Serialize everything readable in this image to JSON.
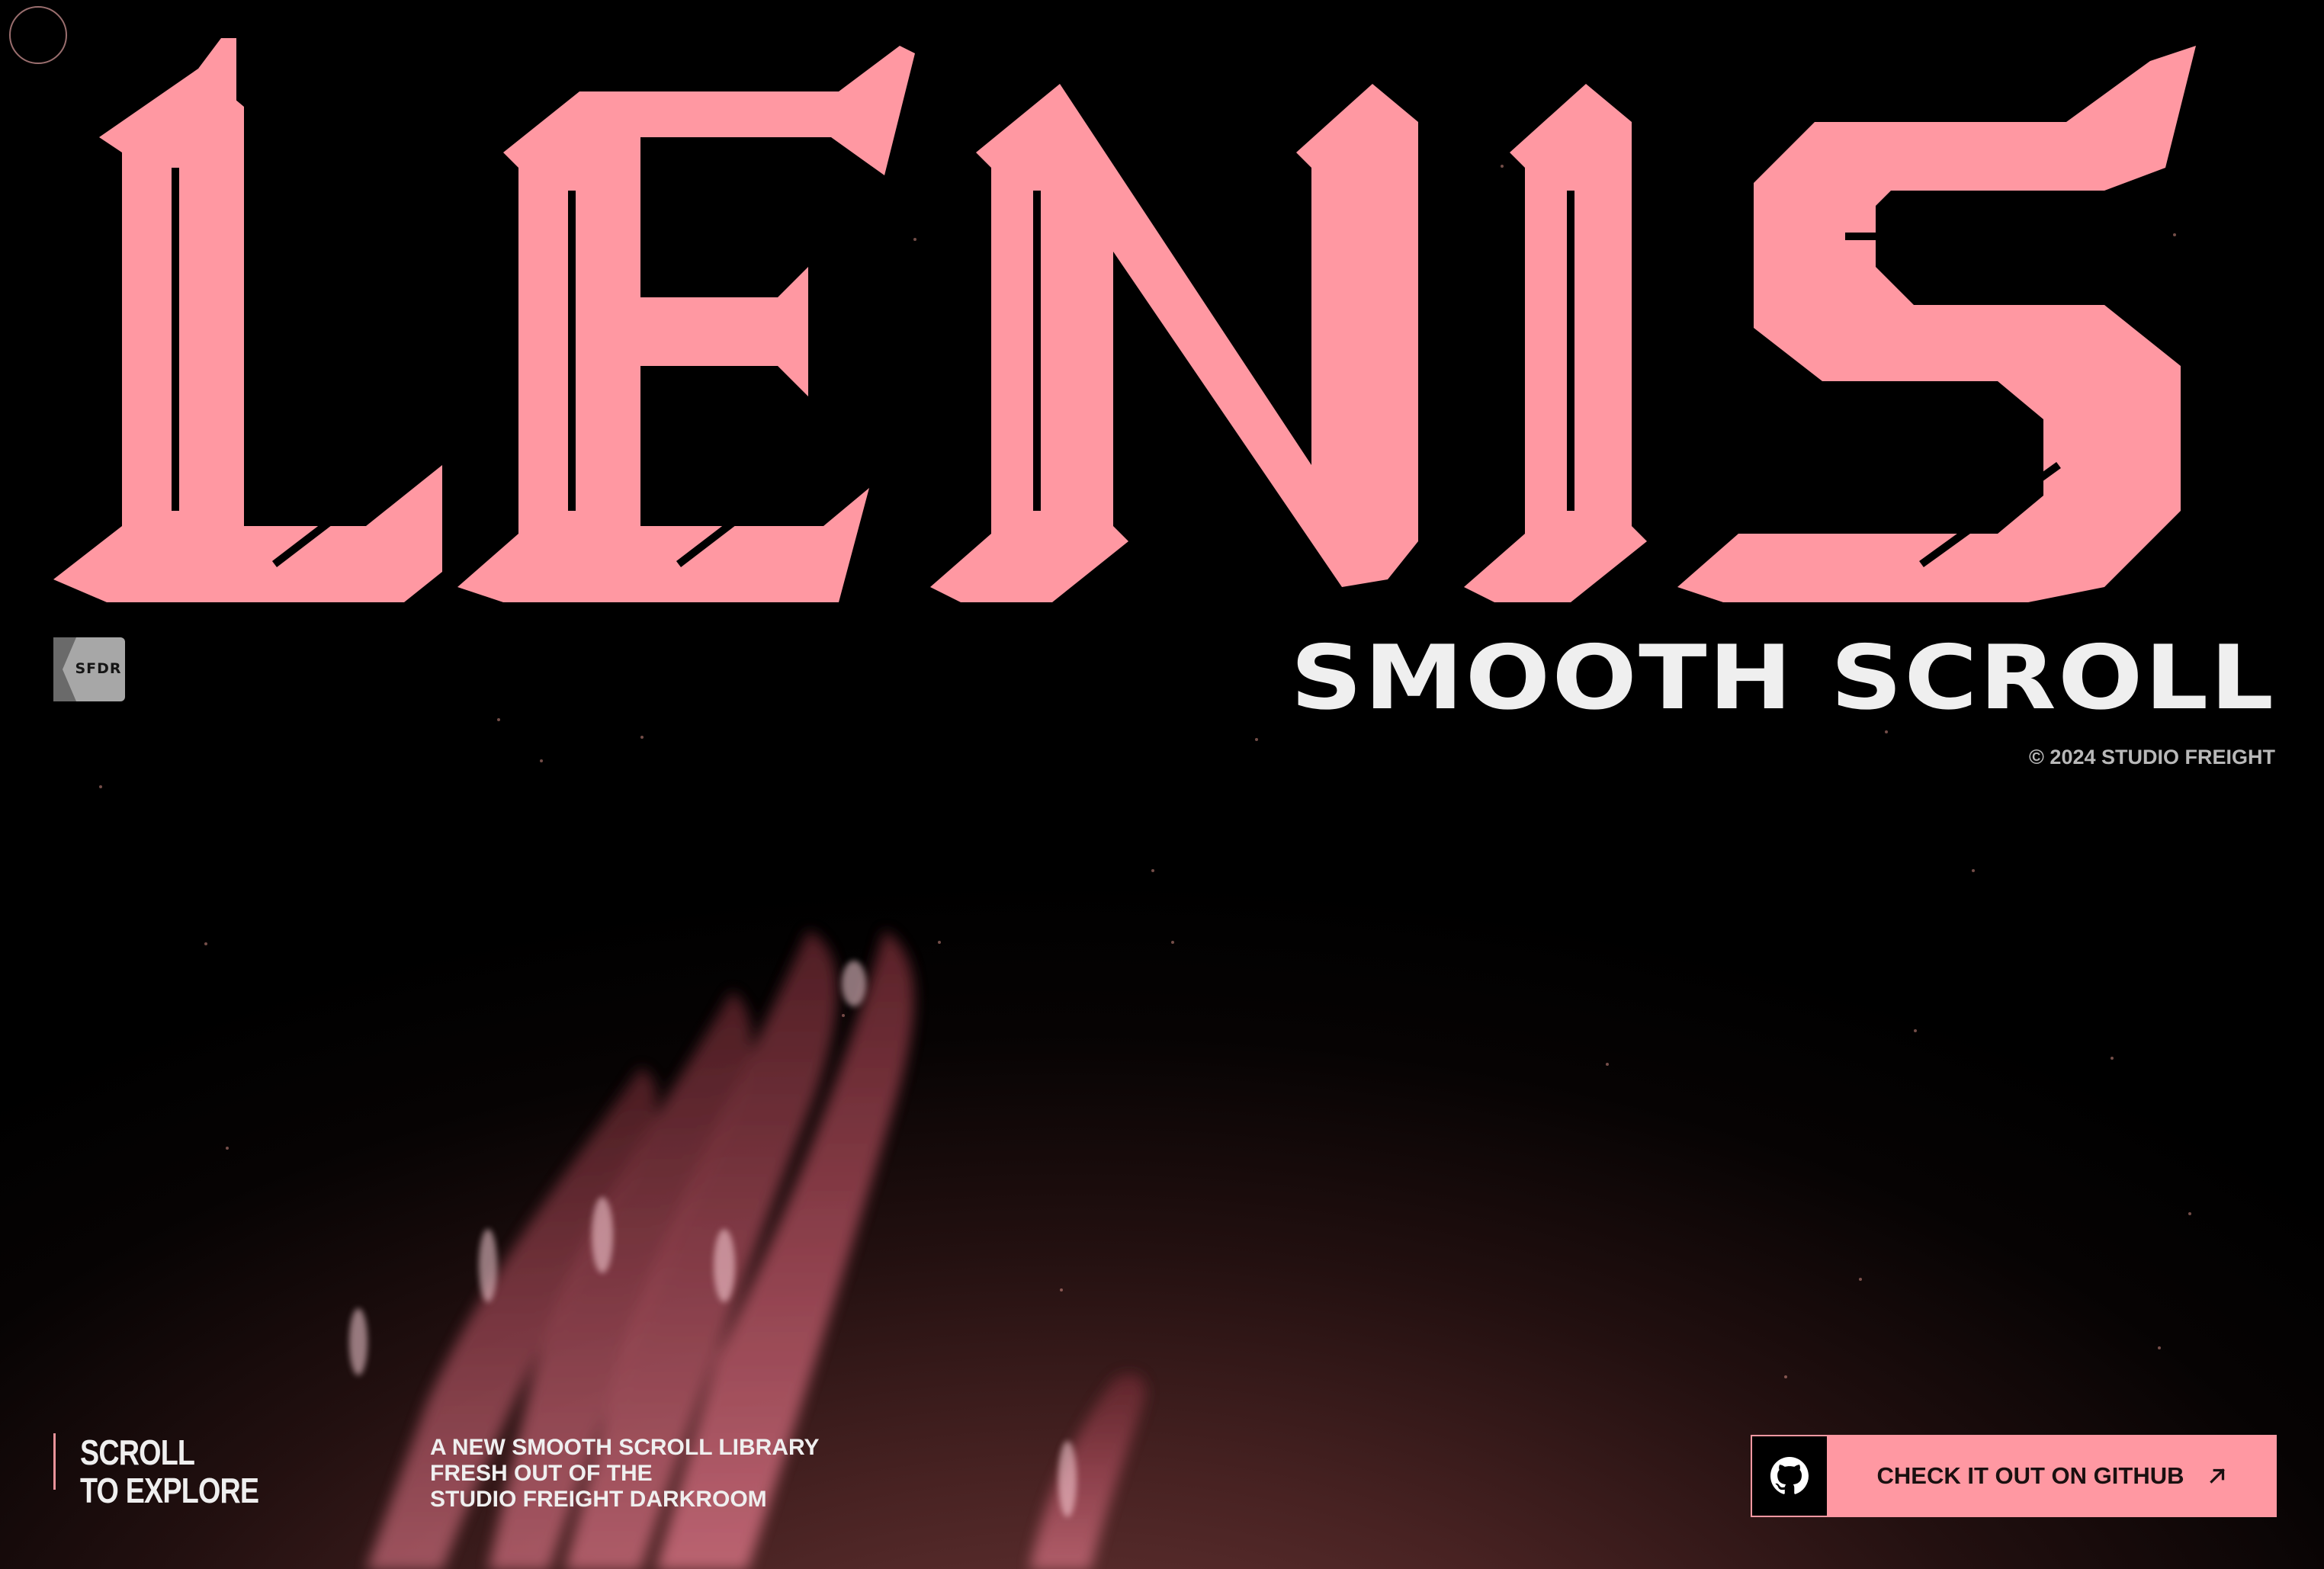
{
  "brand": {
    "logo_text": "LENIS",
    "logo_color": "#ff98a2",
    "badge_text": "SFDR"
  },
  "hero": {
    "subtitle": "SMOOTH SCROLL",
    "copyright": "© 2024 STUDIO FREIGHT"
  },
  "scroll_hint": {
    "line1": "SCROLL",
    "line2": "TO EXPLORE"
  },
  "tagline": {
    "line1": "A NEW SMOOTH SCROLL LIBRARY",
    "line2": "FRESH OUT OF THE",
    "line3": "STUDIO FREIGHT DARKROOM"
  },
  "cta": {
    "label": "CHECK IT OUT ON GITHUB",
    "icon": "github-icon",
    "arrow_icon": "arrow-up-right-icon",
    "accent": "#ff98a2"
  },
  "colors": {
    "background": "#000000",
    "text": "#efefef",
    "accent": "#ff98a2"
  }
}
